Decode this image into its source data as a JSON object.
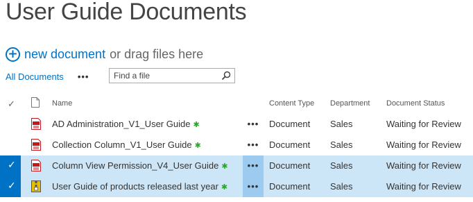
{
  "page": {
    "title": "User Guide Documents"
  },
  "upload": {
    "new_label": "new document",
    "drag_label": "or drag files here",
    "icon": "plus-circle-icon"
  },
  "view": {
    "current": "All Documents",
    "more": "•••"
  },
  "search": {
    "placeholder": "Find a file",
    "value": "",
    "icon": "search-icon"
  },
  "table": {
    "headers": {
      "name": "Name",
      "content_type": "Content Type",
      "department": "Department",
      "status": "Document Status"
    },
    "rows": [
      {
        "name": "AD Administration_V1_User Guide",
        "file_type": "pdf",
        "content_type": "Document",
        "department": "Sales",
        "status": "Waiting for Review",
        "selected": false,
        "dots": "•••",
        "new_mark": "✱"
      },
      {
        "name": "Collection Column_V1_User Guide",
        "file_type": "pdf",
        "content_type": "Document",
        "department": "Sales",
        "status": "Waiting for Review",
        "selected": false,
        "dots": "•••",
        "new_mark": "✱"
      },
      {
        "name": "Column View Permission_V4_User Guide",
        "file_type": "pdf",
        "content_type": "Document",
        "department": "Sales",
        "status": "Waiting for Review",
        "selected": true,
        "dots": "•••",
        "new_mark": "✱"
      },
      {
        "name": "User Guide of products released last year",
        "file_type": "zip",
        "content_type": "Document",
        "department": "Sales",
        "status": "Waiting for Review",
        "selected": true,
        "dots": "•••",
        "new_mark": "✱"
      }
    ]
  },
  "colors": {
    "accent": "#0072c6",
    "selected_row": "#cde6f7",
    "new_mark": "#2aa82a",
    "pdf_icon": "#c8161d",
    "zip_icon": "#e8c000"
  }
}
